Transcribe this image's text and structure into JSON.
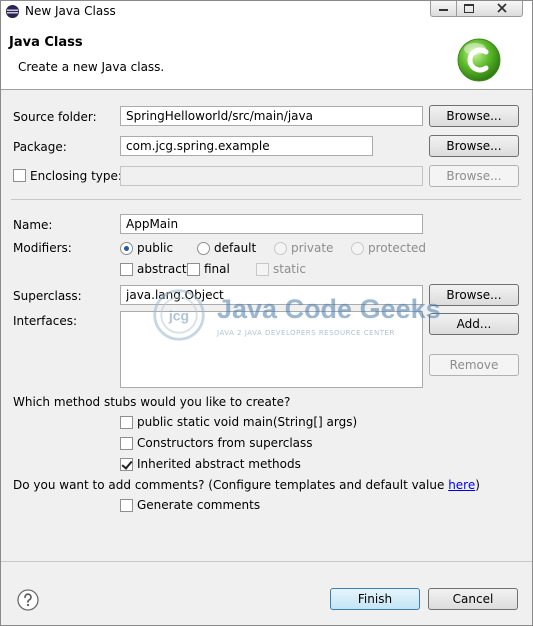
{
  "window": {
    "title": "New Java Class"
  },
  "banner": {
    "title": "Java Class",
    "description": "Create a new Java class."
  },
  "source_folder": {
    "label": "Source folder:",
    "value": "SpringHelloworld/src/main/java",
    "browse": "Browse..."
  },
  "package": {
    "label": "Package:",
    "value": "com.jcg.spring.example",
    "browse": "Browse..."
  },
  "enclosing_type": {
    "label": "Enclosing type:",
    "value": "",
    "checked": false,
    "browse": "Browse..."
  },
  "name": {
    "label": "Name:",
    "value": "AppMain"
  },
  "modifiers": {
    "label": "Modifiers:",
    "public": "public",
    "default": "default",
    "private": "private",
    "protected": "protected",
    "abstract": "abstract",
    "final": "final",
    "static": "static",
    "selected": "public"
  },
  "superclass": {
    "label": "Superclass:",
    "value": "java.lang.Object",
    "browse": "Browse..."
  },
  "interfaces": {
    "label": "Interfaces:",
    "add": "Add...",
    "remove": "Remove",
    "items": []
  },
  "watermark": {
    "name": "Java Code Geeks",
    "tagline": "JAVA 2 JAVA DEVELOPERS RESOURCE CENTER",
    "badge": "jcg"
  },
  "stubs": {
    "question": "Which method stubs would you like to create?",
    "main": "public static void main(String[] args)",
    "constructors": "Constructors from superclass",
    "inherited": "Inherited abstract methods"
  },
  "comments": {
    "question_prefix": "Do you want to add comments? (Configure templates and default value ",
    "link": "here",
    "question_suffix": ")",
    "generate": "Generate comments"
  },
  "footer": {
    "finish": "Finish",
    "cancel": "Cancel"
  },
  "colors": {
    "accent": "#3c7fb1",
    "wizard_icon": "#5bb82a",
    "link": "#0000ee"
  }
}
